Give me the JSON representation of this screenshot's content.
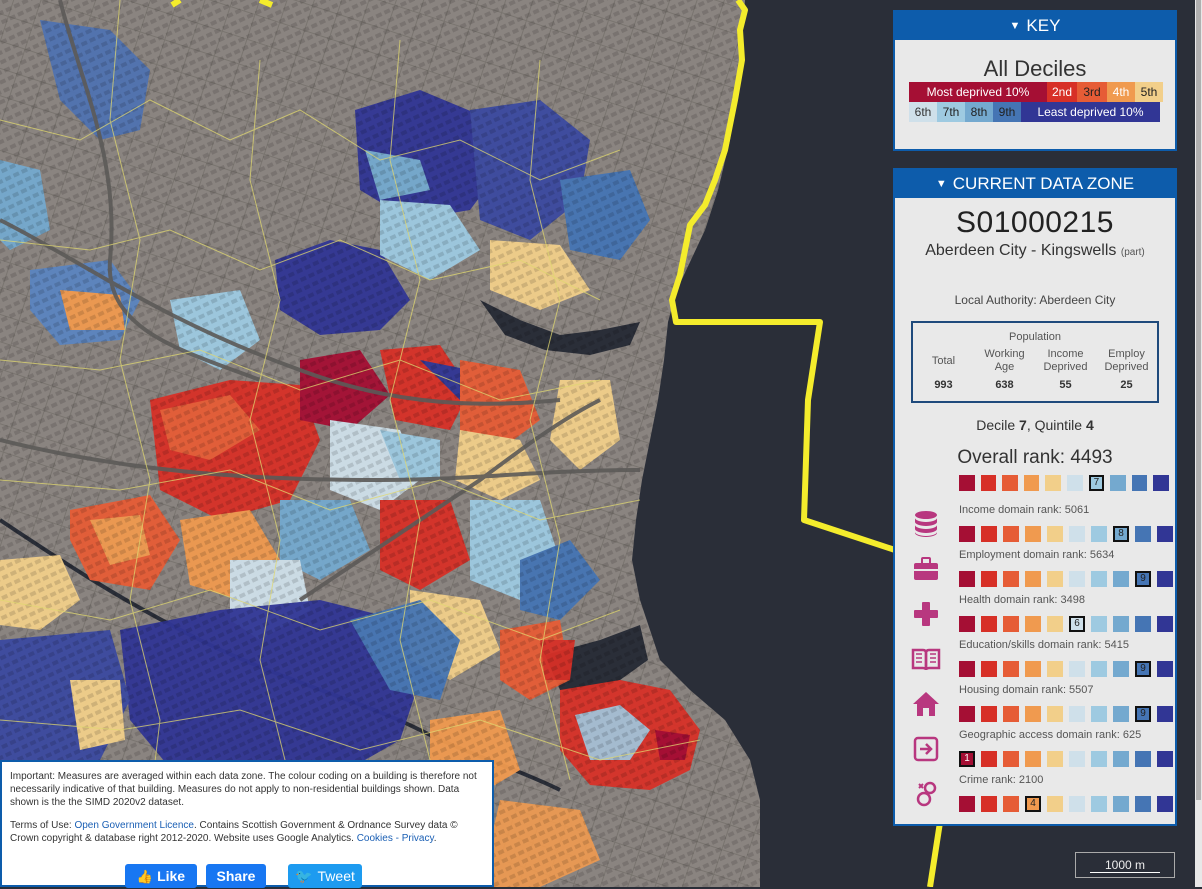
{
  "key": {
    "header": "KEY",
    "title": "All Deciles",
    "row1": [
      {
        "label": "Most deprived 10%",
        "color": "#a50f34",
        "text": "#ffffff"
      },
      {
        "label": "2nd",
        "color": "#d73027",
        "text": "#ffffff"
      },
      {
        "label": "3rd",
        "color": "#e65c36",
        "text": "#222222"
      },
      {
        "label": "4th",
        "color": "#f09a4f",
        "text": "#ffffff"
      },
      {
        "label": "5th",
        "color": "#f2cf8a",
        "text": "#222222"
      }
    ],
    "row2": [
      {
        "label": "6th",
        "color": "#cfe0ea",
        "text": "#333333"
      },
      {
        "label": "7th",
        "color": "#9ecae1",
        "text": "#222222"
      },
      {
        "label": "8th",
        "color": "#74a9cf",
        "text": "#222222"
      },
      {
        "label": "9th",
        "color": "#4575b4",
        "text": "#222222"
      },
      {
        "label": "Least deprived 10%",
        "color": "#313695",
        "text": "#ffffff"
      }
    ]
  },
  "zone": {
    "header": "CURRENT DATA ZONE",
    "id": "S01000215",
    "name": "Aberdeen City - Kingswells",
    "name_suffix": "(part)",
    "local_authority": "Local Authority: Aberdeen City",
    "population_title": "Population",
    "population": [
      {
        "label": "Total",
        "value": "993"
      },
      {
        "label": "Working Age",
        "value": "638"
      },
      {
        "label": "Income Deprived",
        "value": "55"
      },
      {
        "label": "Employ Deprived",
        "value": "25"
      }
    ],
    "decile_word": "Decile",
    "decile": "7",
    "quintile_word": ", Quintile",
    "quintile": "4",
    "overall_label": "Overall rank: 4493",
    "overall_decile": 7,
    "domains": [
      {
        "label": "Income domain rank: 5061",
        "decile": 8,
        "icon": "database-icon"
      },
      {
        "label": "Employment domain rank: 5634",
        "decile": 9,
        "icon": "briefcase-icon"
      },
      {
        "label": "Health domain rank: 3498",
        "decile": 6,
        "icon": "plus-icon"
      },
      {
        "label": "Education/skills domain rank: 5415",
        "decile": 9,
        "icon": "book-icon"
      },
      {
        "label": "Housing domain rank: 5507",
        "decile": 9,
        "icon": "home-icon"
      },
      {
        "label": "Geographic access domain rank: 625",
        "decile": 1,
        "icon": "sign-in-icon"
      },
      {
        "label": "Crime rank: 2100",
        "decile": 4,
        "icon": "crime-icon"
      }
    ]
  },
  "decile_colors": [
    "#a50f34",
    "#d73027",
    "#e65c36",
    "#f09a4f",
    "#f2cf8a",
    "#cfe0ea",
    "#9ecae1",
    "#74a9cf",
    "#4575b4",
    "#313695"
  ],
  "icon_color": "#b8377f",
  "disclaimer": {
    "para1": "Important: Measures are averaged within each data zone. The colour coding on a building is therefore not necessarily indicative of that building. Measures do not apply to non-residential buildings shown. Data shown is the the SIMD 2020v2 dataset.",
    "terms_prefix": "Terms of Use: ",
    "ogl_link": "Open Government Licence",
    "terms_mid": ". Contains Scottish Government & Ordnance Survey data © Crown copyright & database right 2012-2020. Website uses Google Analytics. ",
    "cookies_link": "Cookies - Privacy",
    "terms_end": "."
  },
  "social": {
    "like": "Like",
    "share": "Share",
    "tweet": "Tweet"
  },
  "scale_label": "1000 m"
}
